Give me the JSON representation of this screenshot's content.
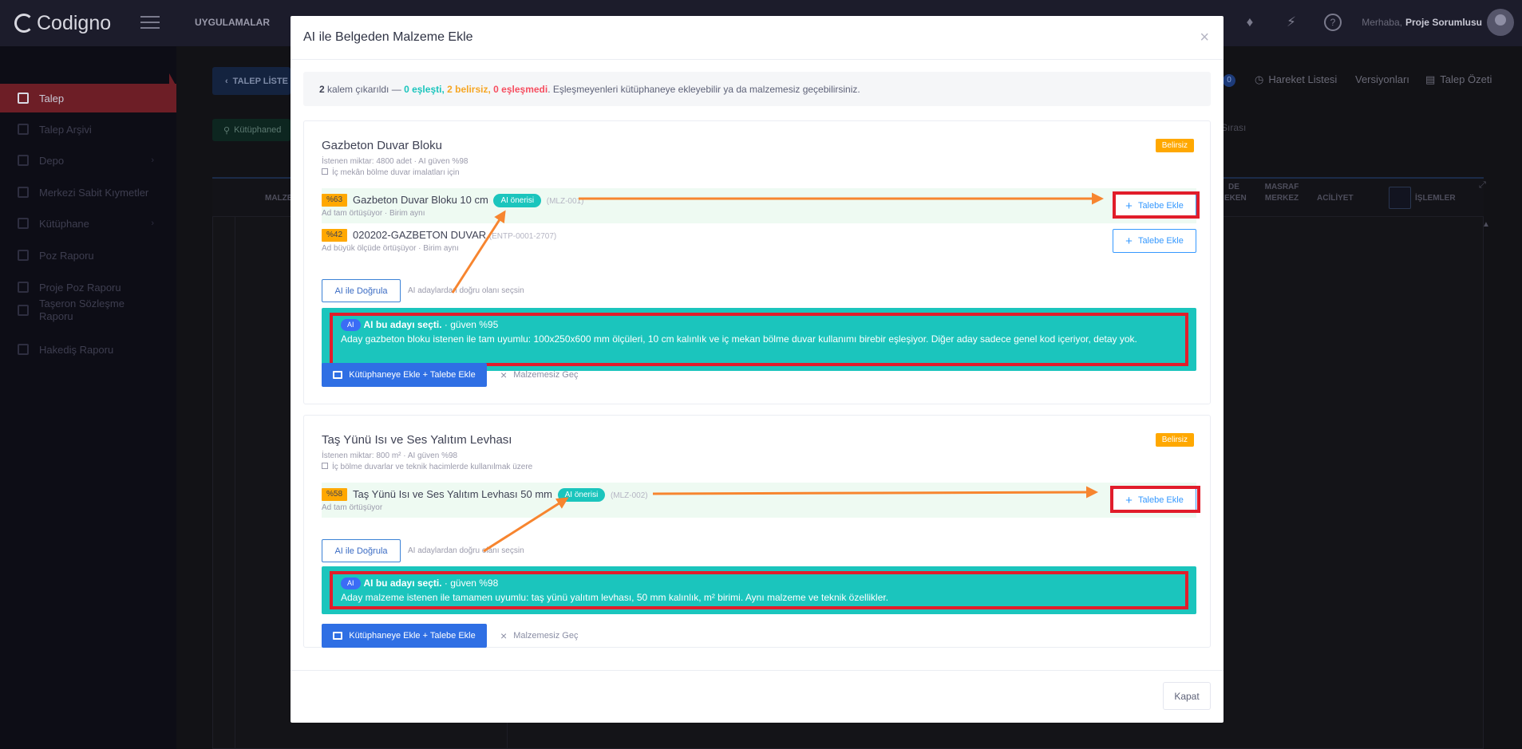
{
  "app": {
    "brand": "Codigno",
    "apps_menu": "UYGULAMALAR",
    "greeting": "Merhaba,",
    "user": "Proje Sorumlusu"
  },
  "sidebar": {
    "items": [
      {
        "label": "Talep"
      },
      {
        "label": "Talep Arşivi"
      },
      {
        "label": "Depo"
      },
      {
        "label": "Merkezi Sabit Kıymetler"
      },
      {
        "label": "Kütüphane"
      },
      {
        "label": "Poz Raporu"
      },
      {
        "label": "Proje Poz Raporu"
      },
      {
        "label": "Taşeron Sözleşme Raporu"
      },
      {
        "label": "Hakediş Raporu"
      }
    ]
  },
  "background": {
    "back_button": "TALEP LİSTE",
    "library_button": "Kütüphaned",
    "badge": "0",
    "tabs": [
      "Hareket Listesi",
      "Versiyonları",
      "Talep Özeti"
    ],
    "right_text": "Sırası",
    "columns": [
      "MALZE",
      "DE EKEN",
      "MASRAF MERKEZ",
      "ACİLİYET",
      "İŞLEMLER"
    ]
  },
  "modal": {
    "title": "AI ile Belgeden Malzeme Ekle",
    "summary": {
      "count": "2",
      "extracted": "kalem çıkarıldı —",
      "matched": "0 eşleşti,",
      "uncertain": "2 belirsiz,",
      "unmatched": "0 eşleşmedi",
      "rest": ". Eşleşmeyenleri kütüphaneye ekleyebilir ya da malzemesiz geçebilirsiniz."
    },
    "cards": [
      {
        "title": "Gazbeton Duvar Bloku",
        "status": "Belirsiz",
        "meta": "İstenen miktar: 4800 adet · AI güven %98",
        "note": "İç mekân bölme duvar imalatları için",
        "candidates": [
          {
            "percent": "%63",
            "name": "Gazbeton Duvar Bloku 10 cm",
            "ai_pill": "AI önerisi",
            "code": "(MLZ-001)",
            "sub": "Ad tam örtüşüyor · Birim aynı",
            "button": "Talebe Ekle"
          },
          {
            "percent": "%42",
            "name": "020202-GAZBETON DUVAR",
            "ai_pill": "",
            "code": "(ENTP-0001-2707)",
            "sub": "Ad büyük ölçüde örtüşüyor · Birim aynı",
            "button": "Talebe Ekle"
          }
        ],
        "verify_button": "AI ile Doğrula",
        "verify_hint": "AI adaylardan doğru olanı seçsin",
        "ai_tag": "AI",
        "ai_choice": "AI bu adayı seçti.",
        "ai_confidence": "· güven %95",
        "ai_reason": "Aday gazbeton bloku istenen ile tam uyumlu: 100x250x600 mm ölçüleri, 10 cm kalınlık ve iç mekan bölme duvar kullanımı birebir eşleşiyor. Diğer aday sadece genel kod içeriyor, detay yok.",
        "add_library_button": "Kütüphaneye Ekle + Talebe Ekle",
        "skip_button": "Malzemesiz Geç"
      },
      {
        "title": "Taş Yünü Isı ve Ses Yalıtım Levhası",
        "status": "Belirsiz",
        "meta": "İstenen miktar: 800 m² · AI güven %98",
        "note": "İç bölme duvarlar ve teknik hacimlerde kullanılmak üzere",
        "candidates": [
          {
            "percent": "%58",
            "name": "Taş Yünü Isı ve Ses Yalıtım Levhası 50 mm",
            "ai_pill": "AI önerisi",
            "code": "(MLZ-002)",
            "sub": "Ad tam örtüşüyor",
            "button": "Talebe Ekle"
          }
        ],
        "verify_button": "AI ile Doğrula",
        "verify_hint": "AI adaylardan doğru olanı seçsin",
        "ai_tag": "AI",
        "ai_choice": "AI bu adayı seçti.",
        "ai_confidence": "· güven %98",
        "ai_reason": "Aday malzeme istenen ile tamamen uyumlu: taş yünü yalıtım levhası, 50 mm kalınlık, m² birimi. Aynı malzeme ve teknik özellikler.",
        "add_library_button": "Kütüphaneye Ekle + Talebe Ekle",
        "skip_button": "Malzemesiz Geç"
      }
    ],
    "close_button": "Kapat"
  },
  "colors": {
    "annotation_red": "#e11d2b",
    "annotation_orange": "#f7852f",
    "teal": "#1bc5bd",
    "amber": "#ffa800",
    "primary": "#2f6fe4"
  }
}
